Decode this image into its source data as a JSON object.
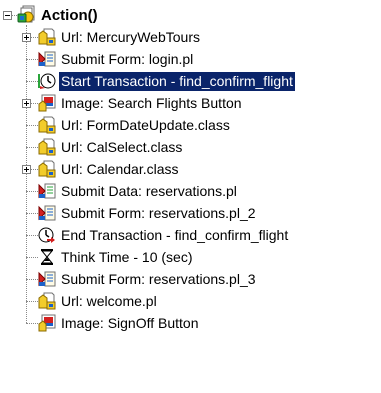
{
  "tree": {
    "root": {
      "label": "Action()",
      "icon": "action-icon",
      "expanded": true
    },
    "items": [
      {
        "label": "Url: MercuryWebTours",
        "icon": "url-icon",
        "expandable": true
      },
      {
        "label": "Submit Form: login.pl",
        "icon": "submit-form-icon",
        "expandable": false
      },
      {
        "label": "Start Transaction - find_confirm_flight",
        "icon": "start-transaction-icon",
        "expandable": false,
        "selected": true
      },
      {
        "label": "Image: Search Flights Button",
        "icon": "image-icon",
        "expandable": true
      },
      {
        "label": "Url: FormDateUpdate.class",
        "icon": "url-icon",
        "expandable": false
      },
      {
        "label": "Url: CalSelect.class",
        "icon": "url-icon",
        "expandable": false
      },
      {
        "label": "Url: Calendar.class",
        "icon": "url-icon",
        "expandable": true
      },
      {
        "label": "Submit Data: reservations.pl",
        "icon": "submit-data-icon",
        "expandable": false
      },
      {
        "label": "Submit Form: reservations.pl_2",
        "icon": "submit-form-icon",
        "expandable": false
      },
      {
        "label": "End Transaction - find_confirm_flight",
        "icon": "end-transaction-icon",
        "expandable": false
      },
      {
        "label": "Think Time - 10 (sec)",
        "icon": "hourglass-icon",
        "expandable": false
      },
      {
        "label": "Submit Form: reservations.pl_3",
        "icon": "submit-form-icon",
        "expandable": false
      },
      {
        "label": "Url: welcome.pl",
        "icon": "url-icon",
        "expandable": false
      },
      {
        "label": "Image: SignOff Button",
        "icon": "image-icon",
        "expandable": false
      }
    ]
  },
  "colors": {
    "selection": "#0a246a",
    "selection_text": "#ffffff"
  }
}
